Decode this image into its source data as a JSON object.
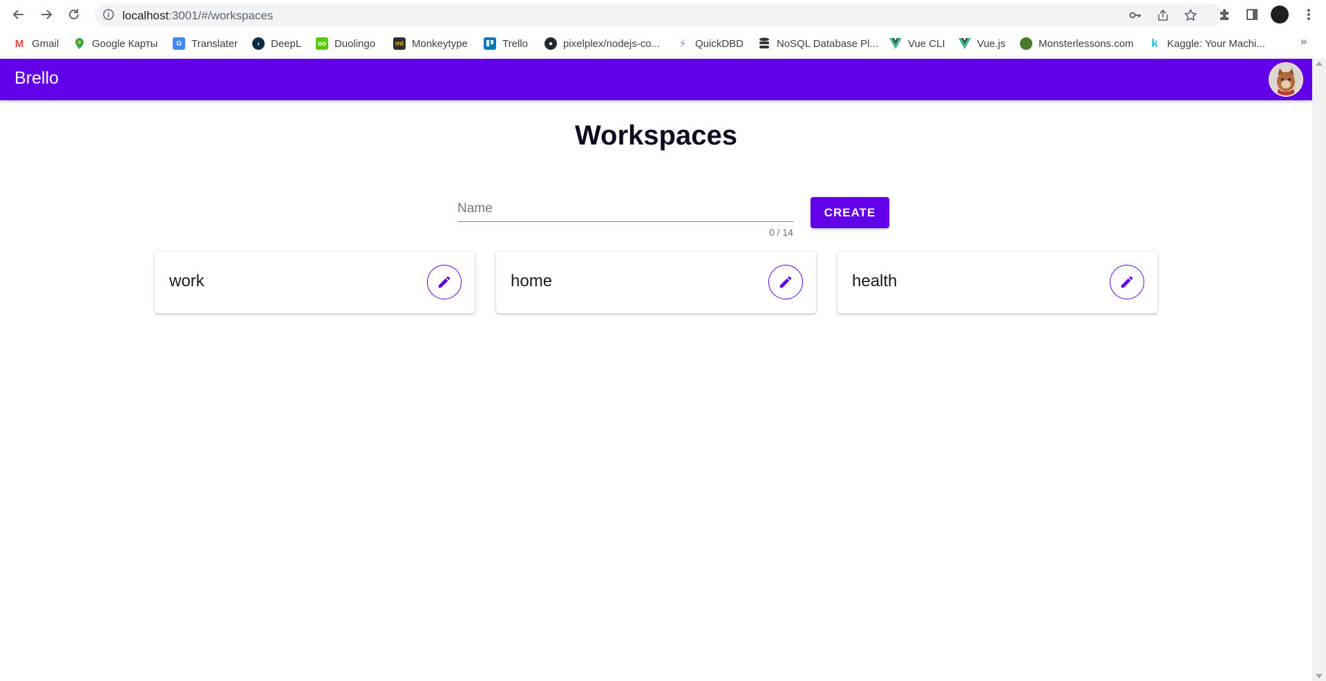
{
  "browser": {
    "url_host": "localhost",
    "url_rest": ":3001/#/workspaces",
    "bookmarks": [
      {
        "label": "Gmail",
        "color": "#ea4335",
        "glyph": "M"
      },
      {
        "label": "Google Карты",
        "color": "#34a853",
        "glyph": ""
      },
      {
        "label": "Translater",
        "color": "#4285f4",
        "glyph": "G"
      },
      {
        "label": "DeepL",
        "color": "#0f2b46",
        "glyph": ""
      },
      {
        "label": "Duolingo",
        "color": "#58cc02",
        "glyph": "oo"
      },
      {
        "label": "Monkeytype",
        "color": "#2c2e31",
        "glyph": "mt"
      },
      {
        "label": "Trello",
        "color": "#0079bf",
        "glyph": ""
      },
      {
        "label": "pixelplex/nodejs-co...",
        "color": "#24292e",
        "glyph": ""
      },
      {
        "label": "QuickDBD",
        "color": "#6b8fd6",
        "glyph": ""
      },
      {
        "label": "NoSQL Database Pl...",
        "color": "#333333",
        "glyph": ""
      },
      {
        "label": "Vue CLI",
        "color": "#42b883",
        "glyph": "V"
      },
      {
        "label": "Vue.js",
        "color": "#42b883",
        "glyph": "V"
      },
      {
        "label": "Monsterlessons.com",
        "color": "#4b7a2a",
        "glyph": ""
      },
      {
        "label": "Kaggle: Your Machi...",
        "color": "#20beff",
        "glyph": "k"
      }
    ],
    "bookmarks_more": "»"
  },
  "app": {
    "brand": "Brello",
    "accent": "#6200ea"
  },
  "page": {
    "title": "Workspaces",
    "name_placeholder": "Name",
    "name_value": "",
    "counter": "0 / 14",
    "create_label": "CREATE"
  },
  "workspaces": [
    {
      "title": "work"
    },
    {
      "title": "home"
    },
    {
      "title": "health"
    }
  ]
}
